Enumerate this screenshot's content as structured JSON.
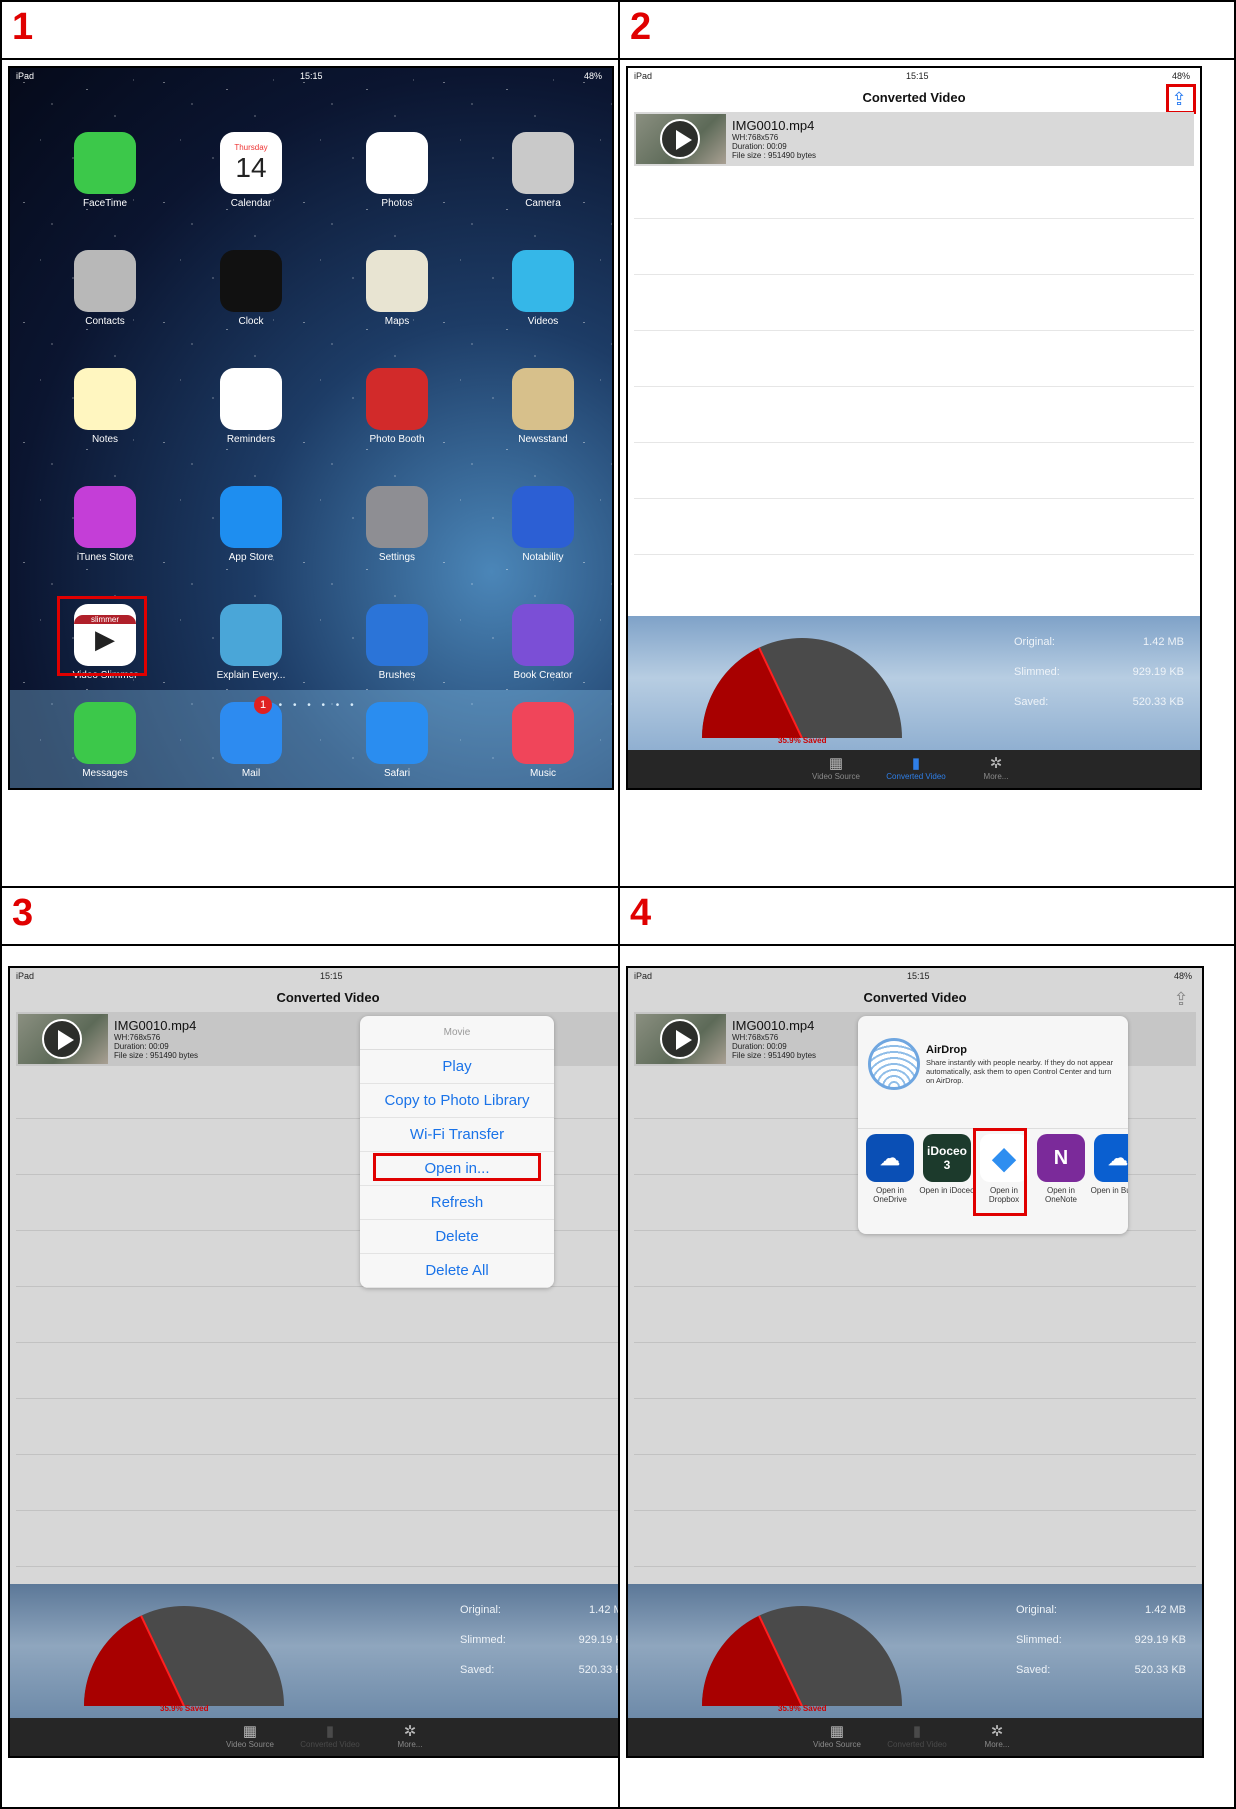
{
  "panels": [
    {
      "number": "1"
    },
    {
      "number": "2"
    },
    {
      "number": "3"
    },
    {
      "number": "4"
    }
  ],
  "status": {
    "carrier": "iPad",
    "time": "15:15",
    "battery": "48%"
  },
  "home": {
    "apps": [
      {
        "label": "FaceTime",
        "icon": "facetime-icon",
        "color": "#3cc84a"
      },
      {
        "label": "Calendar",
        "icon": "calendar-icon",
        "color": "#ffffff",
        "day_name": "Thursday",
        "day": "14"
      },
      {
        "label": "Photos",
        "icon": "photos-icon",
        "color": "#ffffff"
      },
      {
        "label": "Camera",
        "icon": "camera-icon",
        "color": "#c9c9c9"
      },
      {
        "label": "Contacts",
        "icon": "contacts-icon",
        "color": "#b8b8b8"
      },
      {
        "label": "Clock",
        "icon": "clock-icon",
        "color": "#111111"
      },
      {
        "label": "Maps",
        "icon": "maps-icon",
        "color": "#e8e4d2"
      },
      {
        "label": "Videos",
        "icon": "videos-icon",
        "color": "#35b7e8"
      },
      {
        "label": "Notes",
        "icon": "notes-icon",
        "color": "#fff6c0"
      },
      {
        "label": "Reminders",
        "icon": "reminders-icon",
        "color": "#ffffff"
      },
      {
        "label": "Photo Booth",
        "icon": "photo-booth-icon",
        "color": "#d22a2a"
      },
      {
        "label": "Newsstand",
        "icon": "newsstand-icon",
        "color": "#d7c08b"
      },
      {
        "label": "iTunes Store",
        "icon": "itunes-store-icon",
        "color": "#c43ed7"
      },
      {
        "label": "App Store",
        "icon": "app-store-icon",
        "color": "#1e8ef0"
      },
      {
        "label": "Settings",
        "icon": "settings-icon",
        "color": "#8e8e93"
      },
      {
        "label": "Notability",
        "icon": "notability-icon",
        "color": "#2c5fd4"
      },
      {
        "label": "Video Slimmer",
        "icon": "video-slimmer-icon",
        "color": "#ffffff",
        "brand": "slimmer"
      },
      {
        "label": "Explain Every...",
        "icon": "explain-everything-icon",
        "color": "#4aa6d8"
      },
      {
        "label": "Brushes",
        "icon": "brushes-icon",
        "color": "#2b74d8"
      },
      {
        "label": "Book Creator",
        "icon": "book-creator-icon",
        "color": "#7b4fd6"
      }
    ],
    "dock": [
      {
        "label": "Messages",
        "icon": "messages-icon",
        "color": "#3cc84a"
      },
      {
        "label": "Mail",
        "icon": "mail-icon",
        "color": "#2d8bf0",
        "badge": "1"
      },
      {
        "label": "Safari",
        "icon": "safari-icon",
        "color": "#2a8df0"
      },
      {
        "label": "Music",
        "icon": "music-icon",
        "color": "#f0455a"
      }
    ]
  },
  "converted": {
    "title": "Converted Video",
    "video": {
      "name": "IMG0010.mp4",
      "wh": "WH:768x576",
      "duration": "Duration: 00:09",
      "size": "File size : 951490 bytes"
    },
    "stats": {
      "original_label": "Original:",
      "original_value": "1.42 MB",
      "slimmed_label": "Slimmed:",
      "slimmed_value": "929.19 KB",
      "saved_label": "Saved:",
      "saved_value": "520.33 KB",
      "saved_pct_text": "35.9% Saved",
      "saved_fraction": 0.359
    },
    "tabs": [
      "Video Source",
      "Converted Video",
      "More..."
    ]
  },
  "menu": {
    "title": "Movie",
    "items": [
      "Play",
      "Copy to Photo Library",
      "Wi-Fi Transfer",
      "Open in...",
      "Refresh",
      "Delete",
      "Delete All"
    ]
  },
  "share": {
    "airdrop_title": "AirDrop",
    "airdrop_desc": "Share instantly with people nearby. If they do not appear automatically, ask them to open Control Center and turn on AirDrop.",
    "apps": [
      {
        "label": "Open in OneDrive",
        "icon": "onedrive-icon",
        "color": "#0a4fb5",
        "glyph": "☁"
      },
      {
        "label": "Open in iDoceo",
        "icon": "idoceo-icon",
        "color": "#1c3a2c",
        "glyph": "iDoceo 3"
      },
      {
        "label": "Open in Dropbox",
        "icon": "dropbox-icon",
        "color": "#ffffff",
        "glyph": "◆"
      },
      {
        "label": "Open in OneNote",
        "icon": "onenote-icon",
        "color": "#7b2a9a",
        "glyph": "N"
      },
      {
        "label": "Open in Busine",
        "icon": "onedrive-business-icon",
        "color": "#0a5fd0",
        "glyph": "☁"
      }
    ]
  }
}
